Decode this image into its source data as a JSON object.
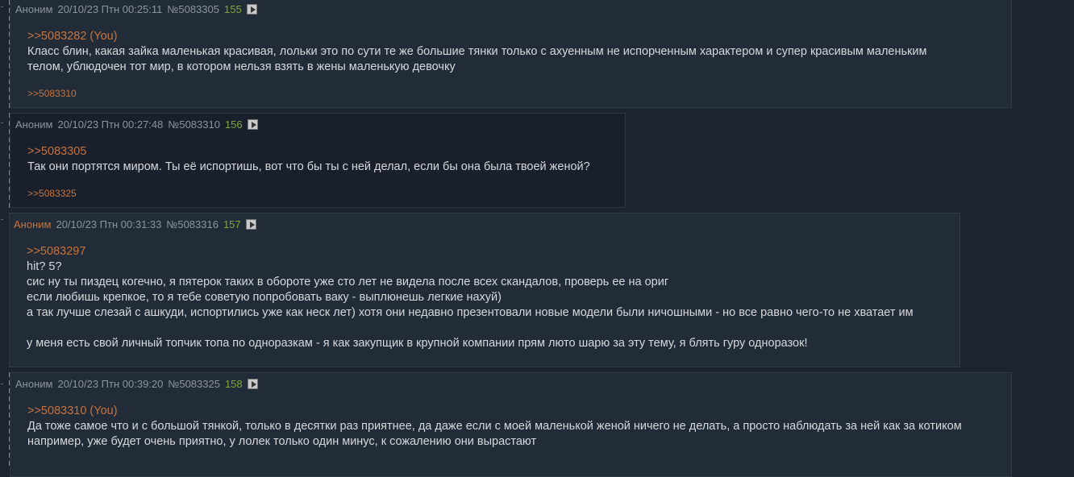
{
  "posts": [
    {
      "name": "Аноним",
      "date": "20/10/23 Птн 00:25:11",
      "num": "№5083305",
      "count": "155",
      "reply": ">>5083282 (You)",
      "lines": [
        "Класс блин, какая зайка маленькая красивая, лольки это по сути те же большие тянки только с ахуенным не испорченным характером и супер красивым маленьким",
        "телом, ублюдочен тот мир, в котором нельзя взять в жены маленькую девочку"
      ],
      "backlink": ">>5083310"
    },
    {
      "name": "Аноним",
      "date": "20/10/23 Птн 00:27:48",
      "num": "№5083310",
      "count": "156",
      "reply": ">>5083305",
      "lines": [
        "Так они портятся миром. Ты её испортишь, вот что бы ты с ней делал, если бы она была твоей женой?"
      ],
      "backlink": ">>5083325"
    },
    {
      "name": "Аноним",
      "date": "20/10/23 Птн 00:31:33",
      "num": "№5083316",
      "count": "157",
      "reply": ">>5083297",
      "lines": [
        "hit? 5?",
        "сис ну ты пиздец когечно, я пятерок таких в обороте уже сто лет не видела после всех скандалов, проверь ее на ориг",
        "если любишь крепкое, то я тебе советую попробовать ваку - выплюнешь легкие нахуй)",
        "а так лучше слезай с ашкуди, испортились уже как неск лет) хотя они недавно презентовали новые модели были ничошными - но все равно чего-то не хватает им",
        "",
        "у меня есть свой личный топчик топа по одноразкам - я как закупщик в крупной компании прям люто шарю за эту тему, я блять гуру одноразок!"
      ]
    },
    {
      "name": "Аноним",
      "date": "20/10/23 Птн 00:39:20",
      "num": "№5083325",
      "count": "158",
      "reply": ">>5083310 (You)",
      "lines": [
        "Да тоже самое что и с большой тянкой, только в десятки раз приятнее, да даже если с моей маленькой женой ничего не делать, а просто наблюдать за ней как за котиком",
        "например, уже будет очень приятно, у лолек только один минус, к сожалению они вырастают"
      ]
    }
  ]
}
